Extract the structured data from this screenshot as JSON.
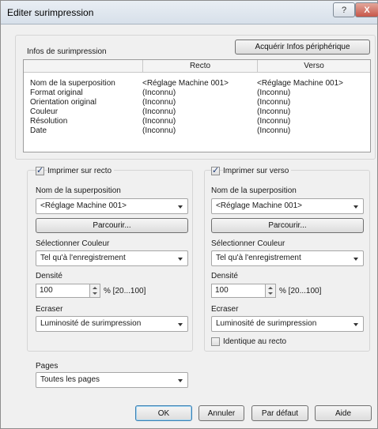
{
  "window": {
    "title": "Editer surimpression"
  },
  "titlebar": {
    "help": "?",
    "close": "X"
  },
  "infos": {
    "group_label": "Infos de surimpression",
    "acquire_button": "Acquérir Infos périphérique",
    "columns": [
      "",
      "Recto",
      "Verso"
    ],
    "rows": [
      {
        "label": "Nom de la superposition",
        "recto": "<Réglage Machine 001>",
        "verso": "<Réglage Machine 001>"
      },
      {
        "label": "Format original",
        "recto": "(Inconnu)",
        "verso": "(Inconnu)"
      },
      {
        "label": "Orientation original",
        "recto": "(Inconnu)",
        "verso": "(Inconnu)"
      },
      {
        "label": "Couleur",
        "recto": "(Inconnu)",
        "verso": "(Inconnu)"
      },
      {
        "label": "Résolution",
        "recto": "(Inconnu)",
        "verso": "(Inconnu)"
      },
      {
        "label": "Date",
        "recto": "(Inconnu)",
        "verso": "(Inconnu)"
      }
    ]
  },
  "recto": {
    "checkbox_label": "Imprimer sur recto",
    "checked": true,
    "overlay_name_label": "Nom de la superposition",
    "overlay_name_value": "<Réglage Machine 001>",
    "browse_button": "Parcourir...",
    "color_label": "Sélectionner Couleur",
    "color_value": "Tel qu'à l'enregistrement",
    "density_label": "Densité",
    "density_value": "100",
    "density_range": "% [20...100]",
    "overwrite_label": "Ecraser",
    "overwrite_value": "Luminosité de surimpression"
  },
  "verso": {
    "checkbox_label": "Imprimer sur verso",
    "checked": true,
    "overlay_name_label": "Nom de la superposition",
    "overlay_name_value": "<Réglage Machine 001>",
    "browse_button": "Parcourir...",
    "color_label": "Sélectionner Couleur",
    "color_value": "Tel qu'à l'enregistrement",
    "density_label": "Densité",
    "density_value": "100",
    "density_range": "% [20...100]",
    "overwrite_label": "Ecraser",
    "overwrite_value": "Luminosité de surimpression",
    "same_as_recto_label": "Identique au recto",
    "same_as_recto_checked": false
  },
  "pages": {
    "label": "Pages",
    "value": "Toutes les pages"
  },
  "footer": {
    "ok": "OK",
    "cancel": "Annuler",
    "default": "Par défaut",
    "help": "Aide"
  }
}
